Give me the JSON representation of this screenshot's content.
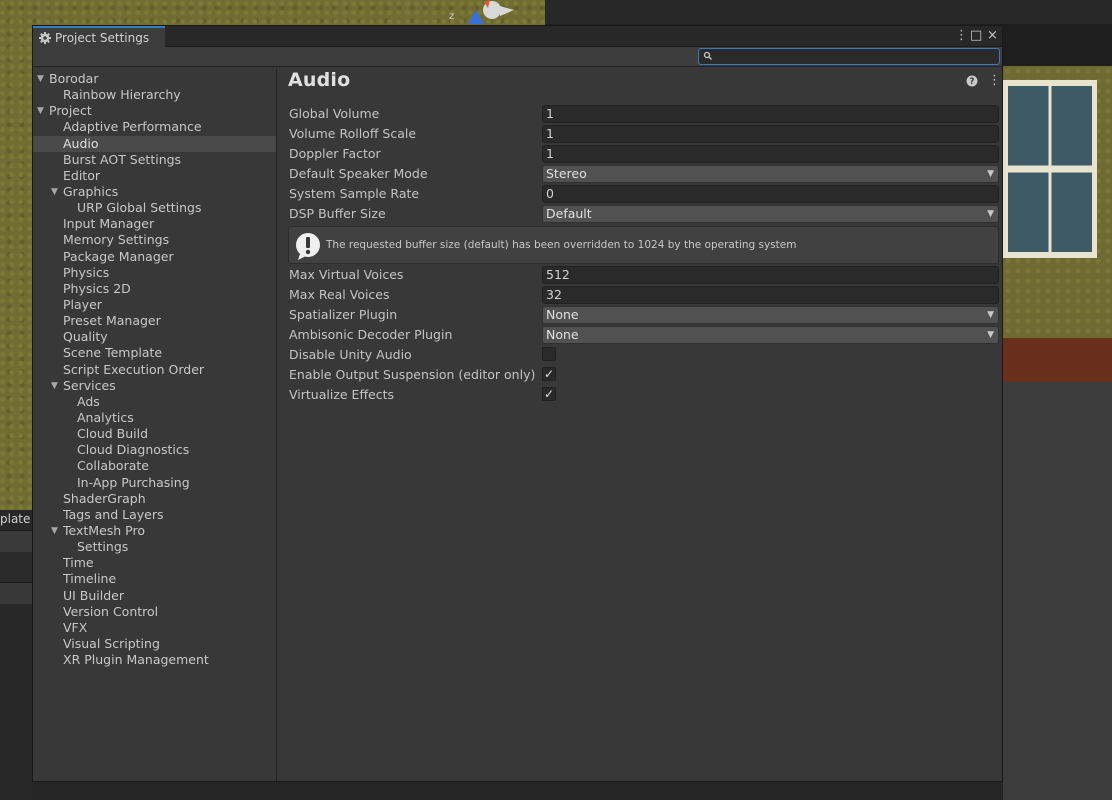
{
  "background": {
    "partial_label": "plate",
    "gizmo_axis": "z"
  },
  "window": {
    "tab_title": "Project Settings",
    "tab_icon": "gear-icon",
    "controls": {
      "menu": "⋮",
      "maximize": "□",
      "close": "×"
    },
    "search": {
      "value": "",
      "placeholder": ""
    }
  },
  "sidebar": {
    "items": [
      {
        "label": "Borodar",
        "depth": 0,
        "expanded": true,
        "has_children": true
      },
      {
        "label": "Rainbow Hierarchy",
        "depth": 1
      },
      {
        "label": "Project",
        "depth": 0,
        "expanded": true,
        "has_children": true
      },
      {
        "label": "Adaptive Performance",
        "depth": 1
      },
      {
        "label": "Audio",
        "depth": 1,
        "selected": true
      },
      {
        "label": "Burst AOT Settings",
        "depth": 1
      },
      {
        "label": "Editor",
        "depth": 1
      },
      {
        "label": "Graphics",
        "depth": 1,
        "expanded": true,
        "has_children": true
      },
      {
        "label": "URP Global Settings",
        "depth": 2
      },
      {
        "label": "Input Manager",
        "depth": 1
      },
      {
        "label": "Memory Settings",
        "depth": 1
      },
      {
        "label": "Package Manager",
        "depth": 1
      },
      {
        "label": "Physics",
        "depth": 1
      },
      {
        "label": "Physics 2D",
        "depth": 1
      },
      {
        "label": "Player",
        "depth": 1
      },
      {
        "label": "Preset Manager",
        "depth": 1
      },
      {
        "label": "Quality",
        "depth": 1
      },
      {
        "label": "Scene Template",
        "depth": 1
      },
      {
        "label": "Script Execution Order",
        "depth": 1
      },
      {
        "label": "Services",
        "depth": 1,
        "expanded": true,
        "has_children": true
      },
      {
        "label": "Ads",
        "depth": 2
      },
      {
        "label": "Analytics",
        "depth": 2
      },
      {
        "label": "Cloud Build",
        "depth": 2
      },
      {
        "label": "Cloud Diagnostics",
        "depth": 2
      },
      {
        "label": "Collaborate",
        "depth": 2
      },
      {
        "label": "In-App Purchasing",
        "depth": 2
      },
      {
        "label": "ShaderGraph",
        "depth": 1
      },
      {
        "label": "Tags and Layers",
        "depth": 1
      },
      {
        "label": "TextMesh Pro",
        "depth": 1,
        "expanded": true,
        "has_children": true
      },
      {
        "label": "Settings",
        "depth": 2
      },
      {
        "label": "Time",
        "depth": 1
      },
      {
        "label": "Timeline",
        "depth": 1
      },
      {
        "label": "UI Builder",
        "depth": 1
      },
      {
        "label": "Version Control",
        "depth": 1
      },
      {
        "label": "VFX",
        "depth": 1
      },
      {
        "label": "Visual Scripting",
        "depth": 1
      },
      {
        "label": "XR Plugin Management",
        "depth": 1
      }
    ]
  },
  "main": {
    "title": "Audio",
    "help_icon": "help-icon",
    "menu_icon": "⋮",
    "fields": {
      "global_volume": {
        "label": "Global Volume",
        "value": "1"
      },
      "volume_rolloff_scale": {
        "label": "Volume Rolloff Scale",
        "value": "1"
      },
      "doppler_factor": {
        "label": "Doppler Factor",
        "value": "1"
      },
      "default_speaker_mode": {
        "label": "Default Speaker Mode",
        "value": "Stereo"
      },
      "system_sample_rate": {
        "label": "System Sample Rate",
        "value": "0"
      },
      "dsp_buffer_size": {
        "label": "DSP Buffer Size",
        "value": "Default"
      },
      "max_virtual_voices": {
        "label": "Max Virtual Voices",
        "value": "512"
      },
      "max_real_voices": {
        "label": "Max Real Voices",
        "value": "32"
      },
      "spatializer_plugin": {
        "label": "Spatializer Plugin",
        "value": "None"
      },
      "ambisonic_decoder_plugin": {
        "label": "Ambisonic Decoder Plugin",
        "value": "None"
      },
      "disable_unity_audio": {
        "label": "Disable Unity Audio",
        "checked": false
      },
      "enable_output_suspension": {
        "label": "Enable Output Suspension (editor only)",
        "checked": true
      },
      "virtualize_effects": {
        "label": "Virtualize Effects",
        "checked": true
      }
    },
    "helpbox": {
      "icon": "warning-icon",
      "text": "The requested buffer size (default) has been overridden to 1024 by the operating system"
    }
  },
  "colors": {
    "accent": "#3a79bb",
    "panel": "#383838",
    "field": "#2a2a2a",
    "dropdown": "#515151",
    "selected_row": "#4a4a4a"
  }
}
